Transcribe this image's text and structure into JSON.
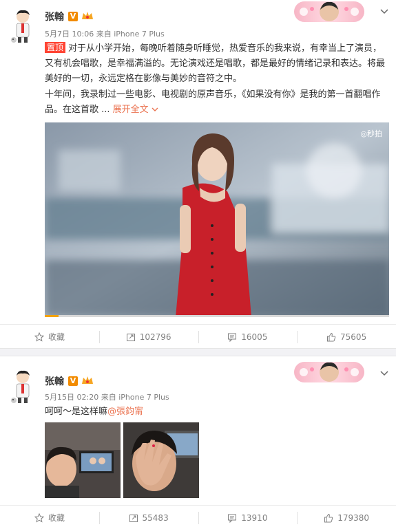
{
  "post1": {
    "author": "张翰",
    "verified_badge": "V",
    "time": "5月7日 10:06",
    "source_prefix": "来自",
    "source": "iPhone 7 Plus",
    "pin_label": "置顶",
    "paragraph1": "对于从小学开始，每晚听着随身听睡觉，热爱音乐的我来说，有幸当上了演员，又有机会唱歌，是幸福满溢的。无论演戏还是唱歌，都是最好的情绪记录和表达。将最美好的一切，永远定格在影像与美妙的音符之中。",
    "paragraph2": "十年间，我录制过一些电影、电视剧的原声音乐，《如果没有你》是我的第一首翻唱作品。在这首歌 ...",
    "expand_label": "展开全文",
    "video_watermark": "秒拍",
    "video_progress": 0.04,
    "actions": {
      "favorite": "收藏",
      "repost": "102796",
      "comment": "16005",
      "like": "75605"
    }
  },
  "post2": {
    "author": "张翰",
    "verified_badge": "V",
    "time": "5月15日 02:20",
    "source_prefix": "来自",
    "source": "iPhone 7 Plus",
    "text": "呵呵～是这样嘛",
    "mention": "@張鈞甯",
    "actions": {
      "favorite": "收藏",
      "repost": "55483",
      "comment": "13910",
      "like": "179380"
    }
  },
  "colors": {
    "accent": "#eb7350",
    "pin": "#ff4433",
    "badge": "#f28b00",
    "meta": "#808080"
  },
  "icons": [
    "star-icon",
    "repost-icon",
    "comment-icon",
    "like-icon",
    "chevron-down-icon",
    "crown-icon"
  ]
}
